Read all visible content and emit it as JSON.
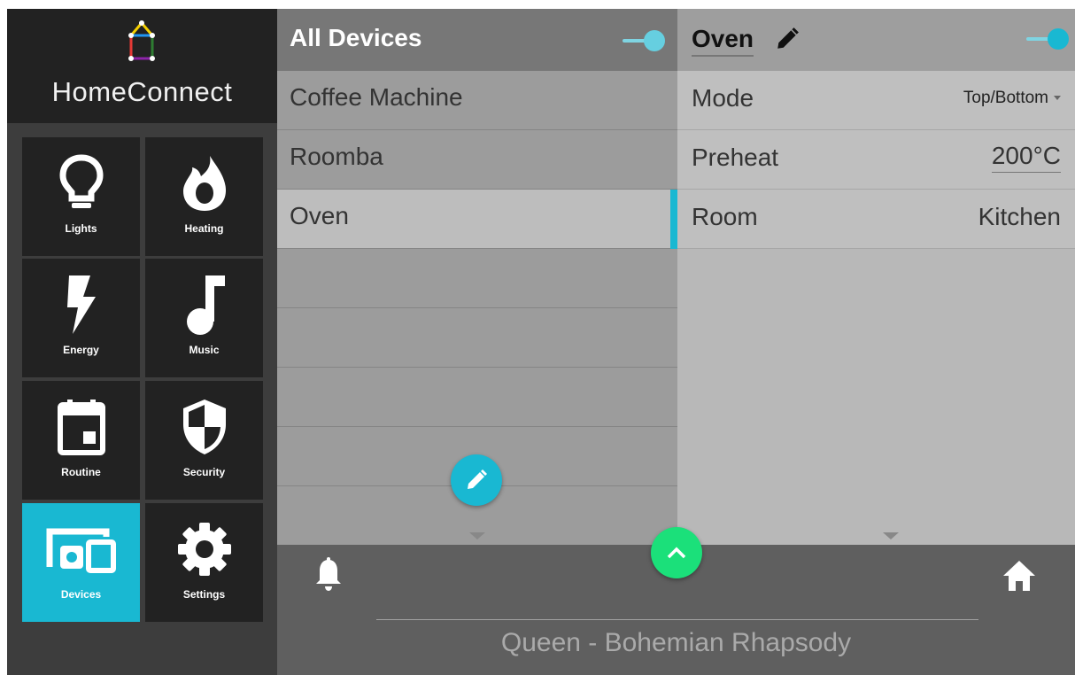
{
  "brand": {
    "name": "HomeConnect"
  },
  "sidebar": {
    "items": [
      {
        "label": "Lights",
        "icon": "lightbulb-icon"
      },
      {
        "label": "Heating",
        "icon": "flame-icon"
      },
      {
        "label": "Energy",
        "icon": "lightning-icon"
      },
      {
        "label": "Music",
        "icon": "music-note-icon"
      },
      {
        "label": "Routine",
        "icon": "calendar-icon"
      },
      {
        "label": "Security",
        "icon": "shield-icon"
      },
      {
        "label": "Devices",
        "icon": "devices-icon",
        "active": true
      },
      {
        "label": "Settings",
        "icon": "gear-icon"
      }
    ]
  },
  "device_list": {
    "title": "All Devices",
    "toggle_on": true,
    "devices": [
      {
        "label": "Coffee Machine"
      },
      {
        "label": "Roomba"
      },
      {
        "label": "Oven",
        "selected": true
      }
    ]
  },
  "detail": {
    "name": "Oven",
    "toggle_on": true,
    "rows": [
      {
        "key": "Mode",
        "value": "Top/Bottom"
      },
      {
        "key": "Preheat",
        "value": "200°C"
      },
      {
        "key": "Room",
        "value": "Kitchen"
      }
    ]
  },
  "now_playing": {
    "text": "Queen - Bohemian Rhapsody"
  },
  "colors": {
    "accent": "#19b8d2",
    "fab_green": "#1be07a",
    "tile_bg": "#222222"
  }
}
